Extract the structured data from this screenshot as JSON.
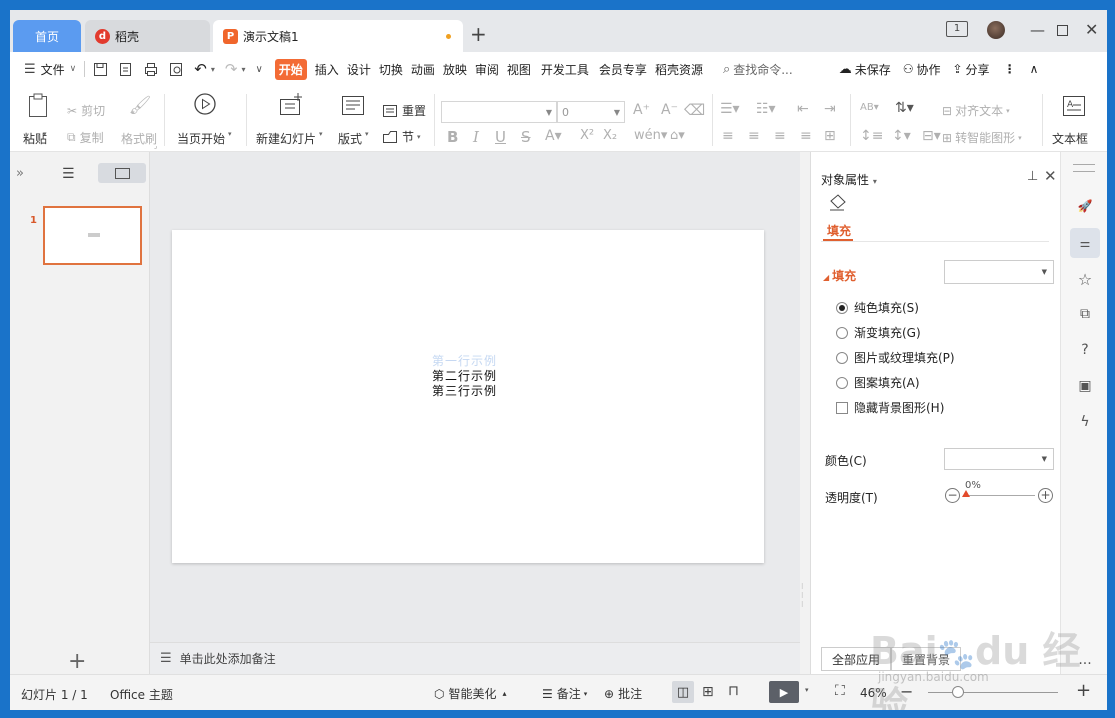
{
  "tabs": {
    "home": "首页",
    "daoke": "稻壳",
    "doc": "演示文稿1",
    "add": "+"
  },
  "menu": {
    "file": "文件",
    "items": [
      "开始",
      "插入",
      "设计",
      "切换",
      "动画",
      "放映",
      "审阅",
      "视图",
      "开发工具",
      "会员专享",
      "稻壳资源"
    ],
    "search": "查找命令...",
    "unsaved": "未保存",
    "collab": "协作",
    "share": "分享"
  },
  "ribbon": {
    "paste": "粘贴",
    "cut": "剪切",
    "copy": "复制",
    "format_painter": "格式刷",
    "from_current": "当页开始",
    "new_slide": "新建幻灯片",
    "layout": "版式",
    "reset": "重置",
    "section": "节",
    "font_size": "0",
    "align_text": "对齐文本",
    "smart_shape": "转智能图形",
    "textbox": "文本框"
  },
  "thumb": {
    "number": "1"
  },
  "slide": {
    "line1": "第一行示例",
    "line2": "第二行示例",
    "line3": "第三行示例"
  },
  "notes": {
    "placeholder": "单击此处添加备注"
  },
  "props": {
    "title": "对象属性",
    "tab_fill": "填充",
    "section_fill": "填充",
    "options": [
      "纯色填充(S)",
      "渐变填充(G)",
      "图片或纹理填充(P)",
      "图案填充(A)"
    ],
    "hide_bg": "隐藏背景图形(H)",
    "color_label": "颜色(C)",
    "transparency_label": "透明度(T)",
    "transparency_value": "0%",
    "apply_all": "全部应用",
    "reset_bg": "重置背景"
  },
  "status": {
    "slide_count": "幻灯片 1 / 1",
    "theme": "Office 主题",
    "beautify": "智能美化",
    "notes": "备注",
    "comment": "批注",
    "zoom": "46%"
  },
  "watermark": {
    "text": "jingyan.baidu.com"
  }
}
